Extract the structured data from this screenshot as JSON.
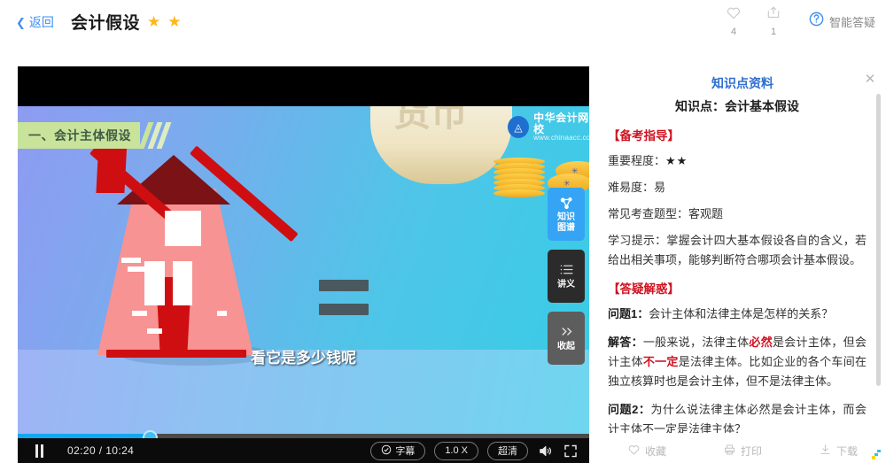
{
  "header": {
    "back_label": "返回",
    "title": "会计假设",
    "star_glyph": "★",
    "star_count": 2,
    "like": {
      "icon": "heart-icon",
      "count": "4"
    },
    "share": {
      "icon": "share-icon",
      "count": "1"
    },
    "smart_qa": {
      "icon": "question-mark-icon",
      "label": "智能答疑"
    }
  },
  "player": {
    "scene_banner": "一、会计主体假设",
    "watermark": {
      "name": "中华会计网校",
      "url": "www.chinaacc.com",
      "logo": "chinaacc-logo-icon"
    },
    "subtitle": "看它是多少钱呢",
    "money_bag_glyph": "货币",
    "side_buttons": [
      {
        "icon": "knowledge-graph-icon",
        "label_line1": "知识",
        "label_line2": "图谱"
      },
      {
        "icon": "list-icon",
        "label_line1": "讲义",
        "label_line2": ""
      },
      {
        "icon": "double-chevron-right-icon",
        "label_line1": "收起",
        "label_line2": ""
      }
    ],
    "controls": {
      "state": "pause-icon",
      "current_time": "02:20",
      "total_time": "10:24",
      "time_display": "02:20 / 10:24",
      "progress_percent": 22.8,
      "subtitle_toggle": "字幕",
      "speed": "1.0 X",
      "quality": "超清",
      "volume_icon": "volume-icon",
      "fullscreen_icon": "fullscreen-icon"
    }
  },
  "panel": {
    "title": "知识点资料",
    "close_icon": "close-icon",
    "knowledge_heading": "知识点：会计基本假设",
    "section1_heading": "【备考指导】",
    "importance_label": "重要程度：",
    "importance_stars": "★★",
    "difficulty": "难易度：易",
    "question_type": "常见考查题型：客观题",
    "study_tip": "学习提示：掌握会计四大基本假设各自的含义，若给出相关事项，能够判断符合哪项会计基本假设。",
    "section2_heading": "【答疑解惑】",
    "q1_label": "问题1：",
    "q1_text": "会计主体和法律主体是怎样的关系？",
    "a1_label": "解答：",
    "a1_part1": "一般来说，法律主体",
    "a1_em1": "必然",
    "a1_part2": "是会计主体，但会计主体",
    "a1_em2": "不一定",
    "a1_part3": "是法律主体。比如企业的各个车间在独立核算时也是会计主体，但不是法律主体。",
    "q2_label": "问题2：",
    "q2_text": "为什么说法律主体必然是会计主体，而会计主体不一定是法律主体？"
  },
  "panel_footer": {
    "actions": [
      {
        "icon": "heart-icon",
        "label": "收藏"
      },
      {
        "icon": "print-icon",
        "label": "打印"
      },
      {
        "icon": "download-icon",
        "label": "下载"
      }
    ]
  },
  "colors": {
    "accent_blue": "#3d8ff0",
    "panel_title_blue": "#2f6fd0",
    "section_red": "#cf1220",
    "star_yellow": "#ffb619",
    "progress_blue": "#12a8ef",
    "knowledge_btn_blue": "#35a4f5"
  }
}
